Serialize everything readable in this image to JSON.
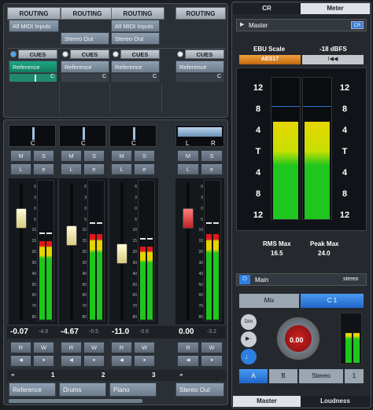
{
  "routing": {
    "headers": [
      "ROUTING",
      "ROUTING",
      "ROUTING",
      "ROUTING"
    ],
    "inputs": [
      "All MIDI Inputs",
      "All MIDI Inputs"
    ],
    "outputs": [
      "Stereo Out",
      "Stereo Out"
    ]
  },
  "cues": {
    "headers": [
      "CUES",
      "CUES",
      "CUES",
      "CUES"
    ],
    "sends": [
      {
        "label": "Reference",
        "value": "C"
      },
      {
        "label": "Reference",
        "value": "C"
      },
      {
        "label": "Reference",
        "value": "C"
      },
      {
        "label": "Reference",
        "value": "C"
      }
    ]
  },
  "channels": [
    {
      "name": "Reference",
      "number": "1",
      "pan": "C",
      "volume": "-0.07",
      "peak": "-4.9",
      "ms": [
        "M",
        "S"
      ],
      "le": [
        "L",
        "e"
      ],
      "rw": [
        "R",
        "W"
      ],
      "fader_level": 0.75,
      "meter_level": 0.56,
      "meter_peak": 0.62
    },
    {
      "name": "Drums",
      "number": "2",
      "pan": "C",
      "volume": "-4.67",
      "peak": "-0.5",
      "ms": [
        "M",
        "S"
      ],
      "le": [
        "L",
        "e"
      ],
      "rw": [
        "R",
        "W"
      ],
      "fader_level": 0.6,
      "meter_level": 0.61,
      "meter_peak": 0.69
    },
    {
      "name": "Piano",
      "number": "3",
      "pan": "C",
      "volume": "-11.0",
      "peak": "-0.6",
      "ms": [
        "M",
        "S"
      ],
      "le": [
        "L",
        "e"
      ],
      "rw": [
        "R",
        "W"
      ],
      "fader_level": 0.45,
      "meter_level": 0.52,
      "meter_peak": 0.58
    },
    {
      "name": "Stereo Out",
      "number": "",
      "pan_l": "L",
      "pan_r": "R",
      "volume": "0.00",
      "peak": "-3.2",
      "ms": [
        "M",
        "S"
      ],
      "le": [
        "L",
        "e"
      ],
      "rw": [
        "R",
        "W"
      ],
      "fader_level": 0.75,
      "meter_level": 0.61,
      "meter_peak": 0.69
    }
  ],
  "fader_scale": [
    "6",
    "3",
    "0",
    "5",
    "10",
    "15",
    "20",
    "30",
    "40",
    "50",
    "60",
    "70",
    "80"
  ],
  "right": {
    "tabs": [
      "CR",
      "Meter"
    ],
    "master_label": "Master",
    "cr_badge": "CR",
    "ebu_label": "EBU Scale",
    "ebu_value": "-18 dBFS",
    "aes_label": "AES17",
    "reset_label": "I◀◀",
    "scale": [
      "12",
      "8",
      "4",
      "T",
      "4",
      "8",
      "12"
    ],
    "rms_label": "RMS Max",
    "rms_value": "16.5",
    "peak_label": "Peak Max",
    "peak_value": "24.0",
    "main_label": "Main",
    "main_format": "stereo",
    "mix_label": "Mix",
    "c1_label": "C 1",
    "dim_label": "Dim",
    "volume_value": "0.00",
    "abs": [
      "A",
      "B",
      "Stereo",
      "1"
    ],
    "bottom_tabs": [
      "Master",
      "Loudness"
    ]
  },
  "colors": {
    "meter_green": "#1ec61e",
    "meter_yellow": "#e6d400",
    "meter_red": "#e01818",
    "fader_yellow": "#f0e6a0",
    "fader_red": "#e04040",
    "accent_blue": "#2d7fe0"
  }
}
